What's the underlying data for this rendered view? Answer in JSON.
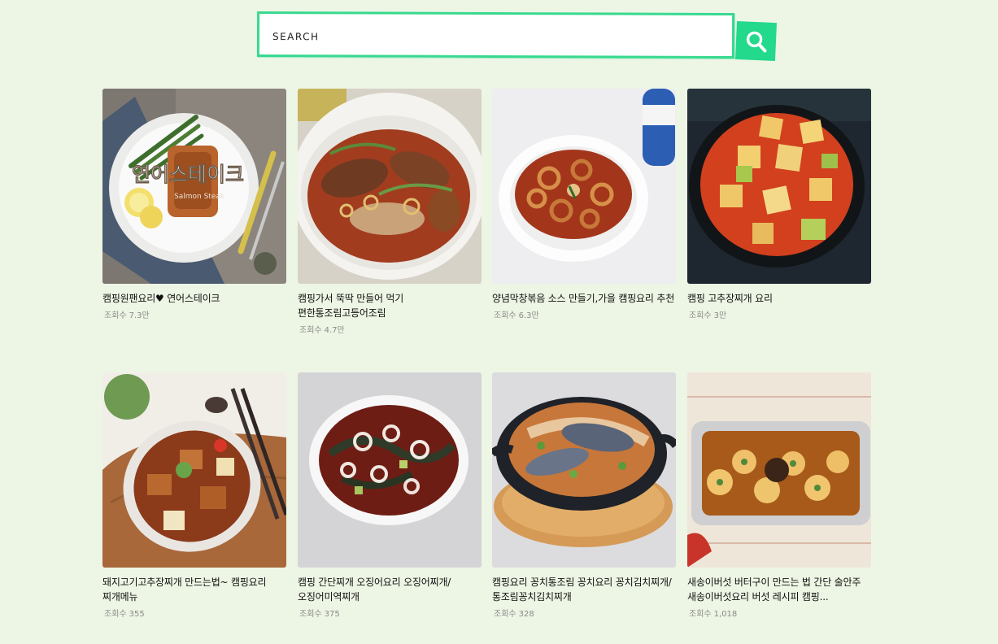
{
  "search": {
    "placeholder": "SEARCH",
    "button_icon": "search-icon"
  },
  "colors": {
    "background": "#edf5e4",
    "accent": "#23d98b"
  },
  "posts": [
    {
      "title": "캠핑원팬요리♥ 연어스테이크",
      "views_label": "조회수",
      "views": "7.3만",
      "overlay_text": "연어스테이크",
      "overlay_sub": "Salmon Steak"
    },
    {
      "title": "캠핑가서 뚝딱 만들어 먹기 편한통조림고등어조림",
      "views_label": "조회수",
      "views": "4.7만"
    },
    {
      "title": "양념막창볶음 소스 만들기,가을 캠핑요리 추천",
      "views_label": "조회수",
      "views": "6.3만"
    },
    {
      "title": "캠핑 고추장찌개 요리",
      "views_label": "조회수",
      "views": "3만"
    },
    {
      "title": "돼지고기고추장찌개 만드는법~ 캠핑요리 찌개메뉴",
      "views_label": "조회수",
      "views": "355"
    },
    {
      "title": "캠핑 간단찌개 오징어요리 오징어찌개/오징어미역찌개",
      "views_label": "조회수",
      "views": "375"
    },
    {
      "title": "캠핑요리 꽁치통조림 꽁치요리 꽁치김치찌개/통조림꽁치김치찌개",
      "views_label": "조회수",
      "views": "328"
    },
    {
      "title": "새송이버섯 버터구이 만드는 법 간단 술안주 새송이버섯요리 버섯 레시피 캠핑...",
      "views_label": "조회수",
      "views": "1,018"
    }
  ]
}
